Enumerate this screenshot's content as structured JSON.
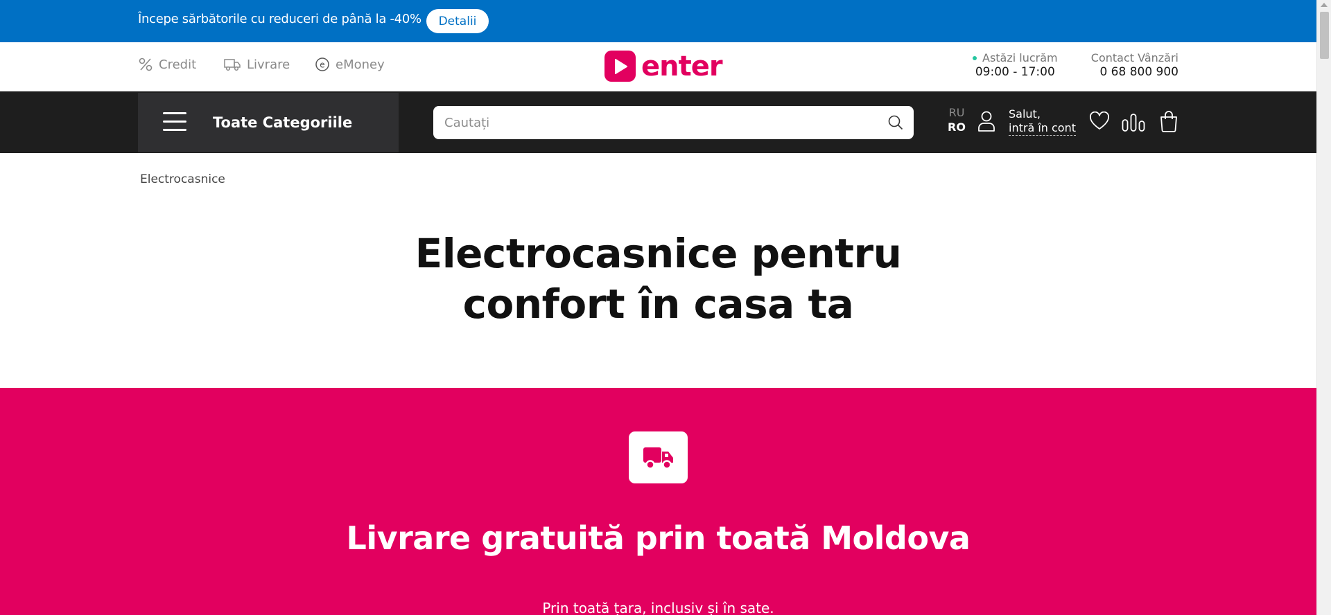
{
  "promo": {
    "text": "Începe sărbătorile cu reduceri de până la -40%",
    "button_label": "Detalii"
  },
  "top_links": [
    {
      "label": "Credit",
      "icon": "percent-icon"
    },
    {
      "label": "Livrare",
      "icon": "truck-icon"
    },
    {
      "label": "eMoney",
      "icon": "emoney-icon"
    }
  ],
  "logo": {
    "text": "enter",
    "icon": "play-icon",
    "color": "#e2005f"
  },
  "schedule": {
    "label": "Astăzi lucrăm",
    "hours": "09:00 - 17:00"
  },
  "contact": {
    "label": "Contact Vânzări",
    "phone": "0 68 800 900"
  },
  "nav": {
    "categories_label": "Toate Categoriile",
    "search_placeholder": "Cautați",
    "lang_ru": "RU",
    "lang_ro": "RO",
    "greeting": "Salut,",
    "login_link": "intră în cont"
  },
  "breadcrumb": "Electrocasnice",
  "hero": {
    "title_line1": "Electrocasnice pentru",
    "title_line2": "confort în casa ta"
  },
  "feature": {
    "icon": "truck-icon",
    "title": "Livrare gratuită prin toată Moldova",
    "subtitle": "Prin toată țara, inclusiv și în sate."
  },
  "colors": {
    "promo_bar": "#0070c4",
    "brand": "#e2005f",
    "navbar": "#1e1e1e",
    "categories_button": "#2f2f31"
  }
}
